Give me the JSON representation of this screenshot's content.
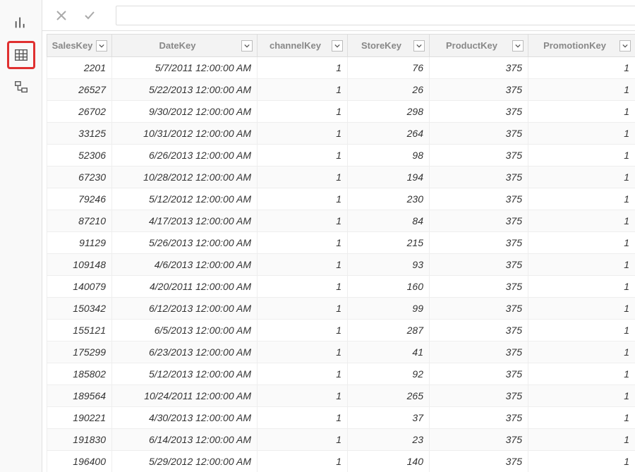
{
  "sidebar": {
    "items": [
      {
        "name": "report-view-button",
        "icon": "chart-icon",
        "selected": false
      },
      {
        "name": "data-view-button",
        "icon": "table-icon",
        "selected": true
      },
      {
        "name": "model-view-button",
        "icon": "model-icon",
        "selected": false
      }
    ]
  },
  "topbar": {
    "cancel_label": "",
    "commit_label": "",
    "formula_value": ""
  },
  "table": {
    "columns": [
      {
        "field": "SalesKey",
        "label": "SalesKey",
        "css": "col-sales"
      },
      {
        "field": "DateKey",
        "label": "DateKey",
        "css": "col-date"
      },
      {
        "field": "channelKey",
        "label": "channelKey",
        "css": "col-chan"
      },
      {
        "field": "StoreKey",
        "label": "StoreKey",
        "css": "col-store"
      },
      {
        "field": "ProductKey",
        "label": "ProductKey",
        "css": "col-prod"
      },
      {
        "field": "PromotionKey",
        "label": "PromotionKey",
        "css": "col-promo"
      }
    ],
    "rows": [
      {
        "SalesKey": "2201",
        "DateKey": "5/7/2011 12:00:00 AM",
        "channelKey": "1",
        "StoreKey": "76",
        "ProductKey": "375",
        "PromotionKey": "1"
      },
      {
        "SalesKey": "26527",
        "DateKey": "5/22/2013 12:00:00 AM",
        "channelKey": "1",
        "StoreKey": "26",
        "ProductKey": "375",
        "PromotionKey": "1"
      },
      {
        "SalesKey": "26702",
        "DateKey": "9/30/2012 12:00:00 AM",
        "channelKey": "1",
        "StoreKey": "298",
        "ProductKey": "375",
        "PromotionKey": "1"
      },
      {
        "SalesKey": "33125",
        "DateKey": "10/31/2012 12:00:00 AM",
        "channelKey": "1",
        "StoreKey": "264",
        "ProductKey": "375",
        "PromotionKey": "1"
      },
      {
        "SalesKey": "52306",
        "DateKey": "6/26/2013 12:00:00 AM",
        "channelKey": "1",
        "StoreKey": "98",
        "ProductKey": "375",
        "PromotionKey": "1"
      },
      {
        "SalesKey": "67230",
        "DateKey": "10/28/2012 12:00:00 AM",
        "channelKey": "1",
        "StoreKey": "194",
        "ProductKey": "375",
        "PromotionKey": "1"
      },
      {
        "SalesKey": "79246",
        "DateKey": "5/12/2012 12:00:00 AM",
        "channelKey": "1",
        "StoreKey": "230",
        "ProductKey": "375",
        "PromotionKey": "1"
      },
      {
        "SalesKey": "87210",
        "DateKey": "4/17/2013 12:00:00 AM",
        "channelKey": "1",
        "StoreKey": "84",
        "ProductKey": "375",
        "PromotionKey": "1"
      },
      {
        "SalesKey": "91129",
        "DateKey": "5/26/2013 12:00:00 AM",
        "channelKey": "1",
        "StoreKey": "215",
        "ProductKey": "375",
        "PromotionKey": "1"
      },
      {
        "SalesKey": "109148",
        "DateKey": "4/6/2013 12:00:00 AM",
        "channelKey": "1",
        "StoreKey": "93",
        "ProductKey": "375",
        "PromotionKey": "1"
      },
      {
        "SalesKey": "140079",
        "DateKey": "4/20/2011 12:00:00 AM",
        "channelKey": "1",
        "StoreKey": "160",
        "ProductKey": "375",
        "PromotionKey": "1"
      },
      {
        "SalesKey": "150342",
        "DateKey": "6/12/2013 12:00:00 AM",
        "channelKey": "1",
        "StoreKey": "99",
        "ProductKey": "375",
        "PromotionKey": "1"
      },
      {
        "SalesKey": "155121",
        "DateKey": "6/5/2013 12:00:00 AM",
        "channelKey": "1",
        "StoreKey": "287",
        "ProductKey": "375",
        "PromotionKey": "1"
      },
      {
        "SalesKey": "175299",
        "DateKey": "6/23/2013 12:00:00 AM",
        "channelKey": "1",
        "StoreKey": "41",
        "ProductKey": "375",
        "PromotionKey": "1"
      },
      {
        "SalesKey": "185802",
        "DateKey": "5/12/2013 12:00:00 AM",
        "channelKey": "1",
        "StoreKey": "92",
        "ProductKey": "375",
        "PromotionKey": "1"
      },
      {
        "SalesKey": "189564",
        "DateKey": "10/24/2011 12:00:00 AM",
        "channelKey": "1",
        "StoreKey": "265",
        "ProductKey": "375",
        "PromotionKey": "1"
      },
      {
        "SalesKey": "190221",
        "DateKey": "4/30/2013 12:00:00 AM",
        "channelKey": "1",
        "StoreKey": "37",
        "ProductKey": "375",
        "PromotionKey": "1"
      },
      {
        "SalesKey": "191830",
        "DateKey": "6/14/2013 12:00:00 AM",
        "channelKey": "1",
        "StoreKey": "23",
        "ProductKey": "375",
        "PromotionKey": "1"
      },
      {
        "SalesKey": "196400",
        "DateKey": "5/29/2012 12:00:00 AM",
        "channelKey": "1",
        "StoreKey": "140",
        "ProductKey": "375",
        "PromotionKey": "1"
      }
    ]
  }
}
